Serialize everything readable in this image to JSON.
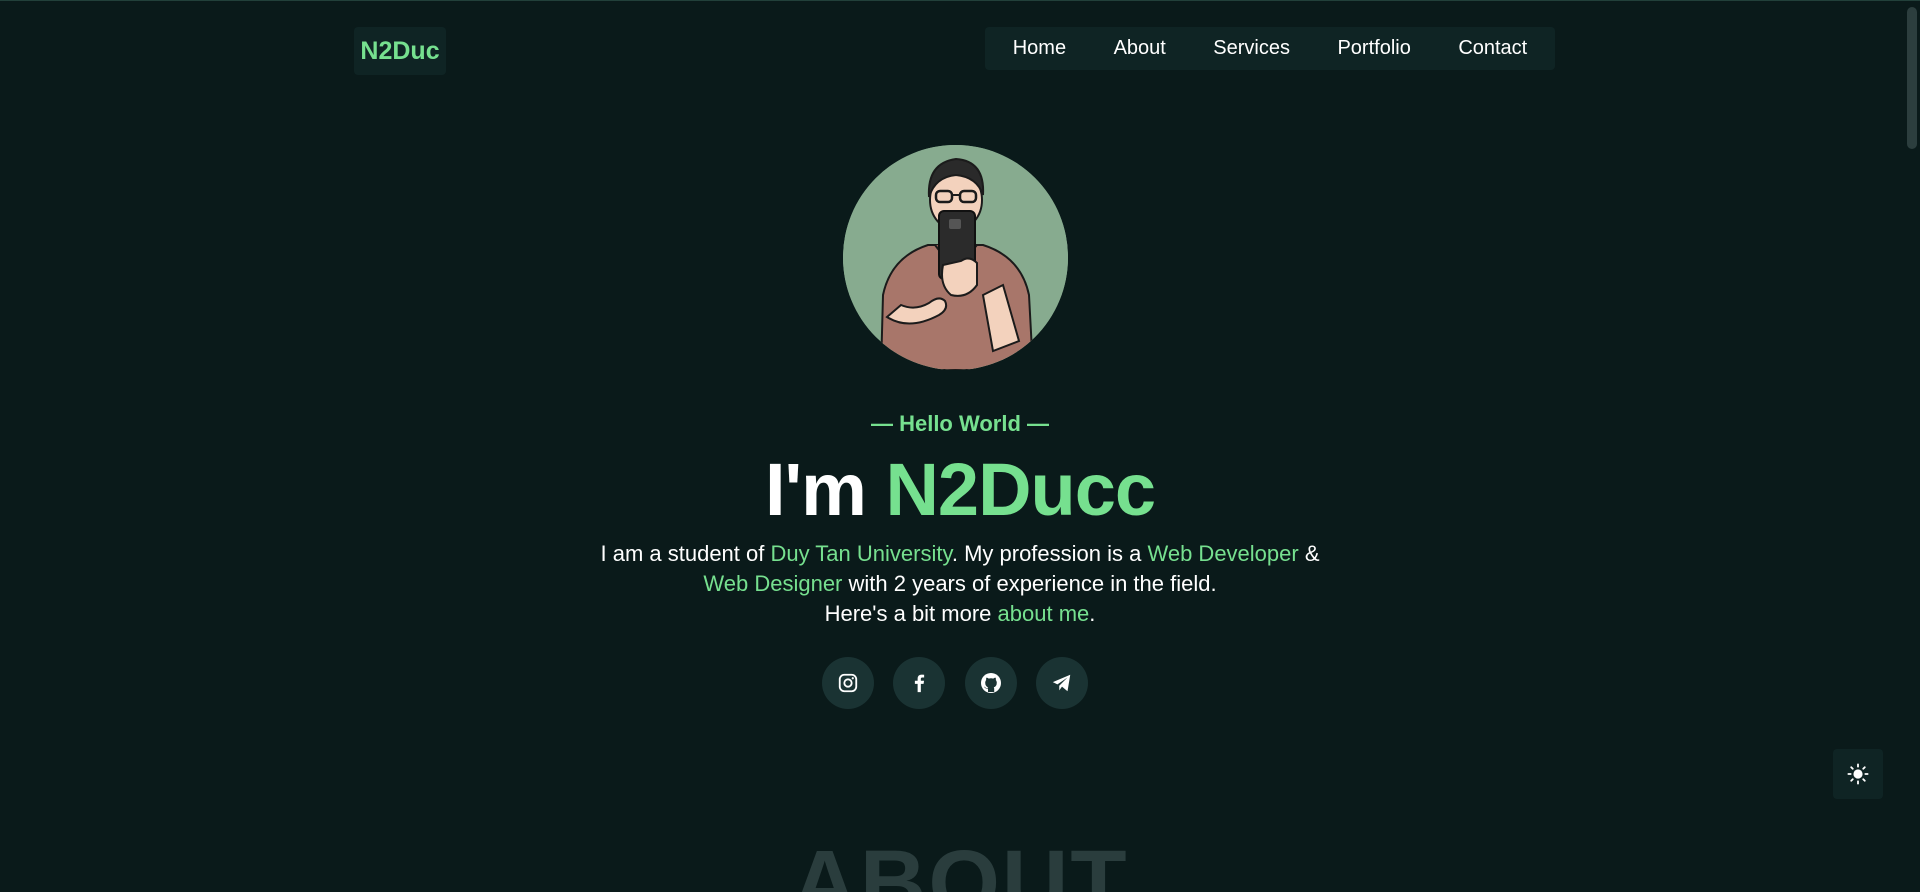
{
  "nav": {
    "logo": "N2Duc",
    "links": [
      "Home",
      "About",
      "Services",
      "Portfolio",
      "Contact"
    ]
  },
  "hero": {
    "avatar_alt": "avatar",
    "greeting": "— Hello World —",
    "headline_prefix": "I'm ",
    "headline_name": "N2Ducc",
    "bio": {
      "part1": "I am a student of ",
      "university": "Duy Tan University",
      "part2": ". My profession is a ",
      "role1": "Web Developer",
      "part3": " &",
      "role2": "Web Designer",
      "part4": " with 2 years of experience in the field.",
      "part5": "Here's a bit more ",
      "about_link": "about me",
      "part6": "."
    },
    "socials": [
      {
        "name": "instagram-icon"
      },
      {
        "name": "facebook-icon"
      },
      {
        "name": "github-icon"
      },
      {
        "name": "telegram-icon"
      }
    ]
  },
  "theme_toggle": {
    "icon": "sun-icon"
  },
  "next_section_title": "ABOUT",
  "colors": {
    "background": "#0a1a1a",
    "accent": "#76e08f",
    "panel": "#0f2424",
    "social_bg": "#1a3333"
  }
}
